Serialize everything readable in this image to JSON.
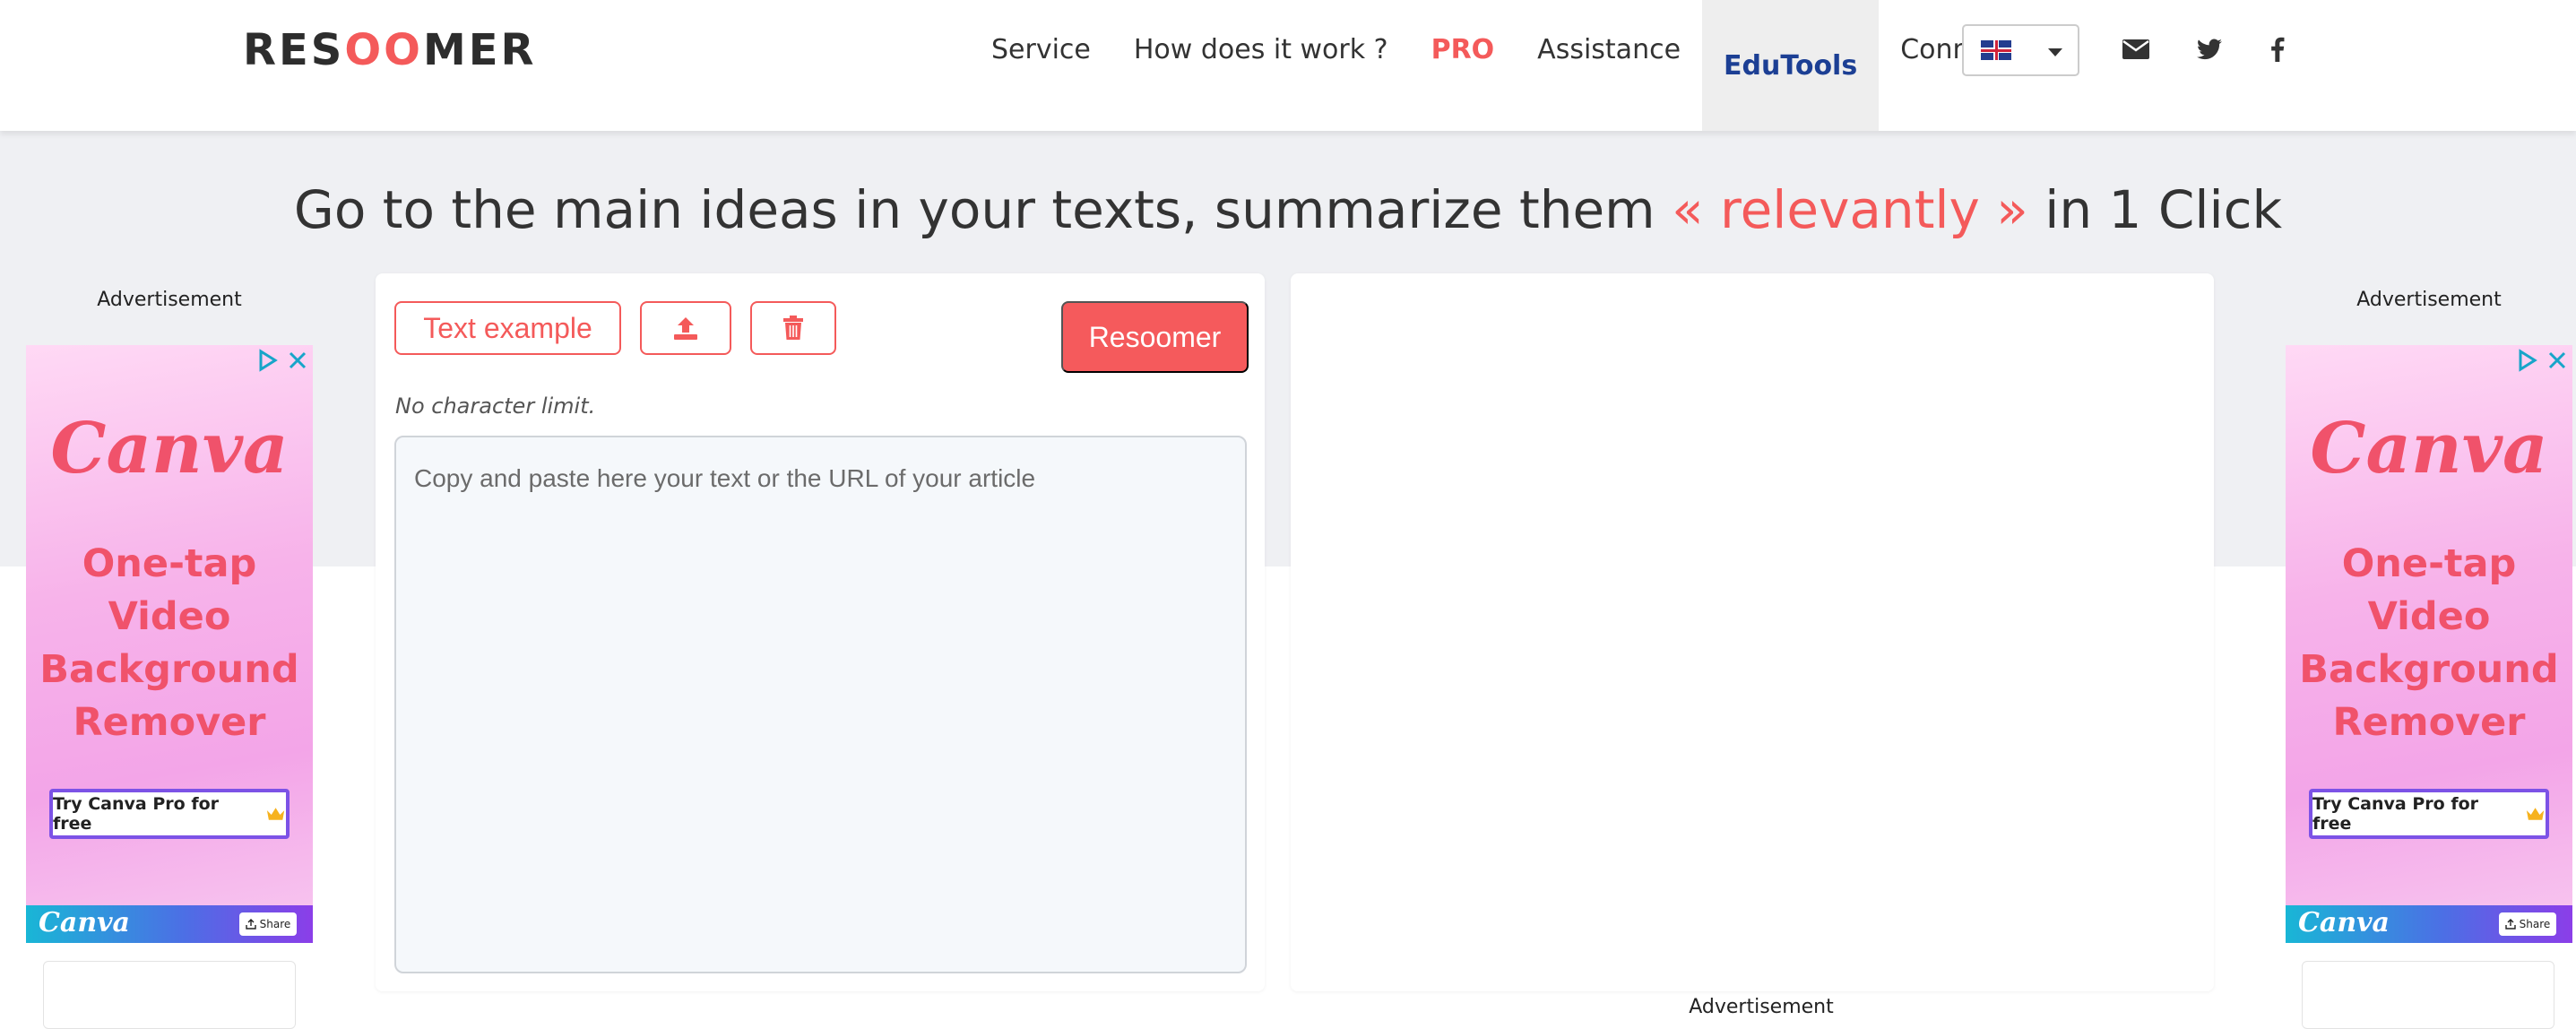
{
  "header": {
    "logo_start": "RES",
    "logo_mid": "OO",
    "logo_end": "MER",
    "nav": [
      {
        "label": "Service"
      },
      {
        "label": "How does it work ?"
      },
      {
        "label": "PRO"
      },
      {
        "label": "Assistance"
      },
      {
        "label": "EduTools"
      },
      {
        "label": "Connexion"
      }
    ],
    "language": "en-GB",
    "social_icons": [
      "envelope-icon",
      "twitter-icon",
      "facebook-icon"
    ]
  },
  "headline": {
    "before": "Go to the main ideas in your texts, summarize them ",
    "accent": "« relevantly »",
    "after": " in 1 Click"
  },
  "tool": {
    "text_example_label": "Text example",
    "upload_icon": "upload-icon",
    "trash_icon": "trash-icon",
    "submit_label": "Resoomer",
    "limit_note": "No character limit.",
    "textarea_placeholder": "Copy and paste here your text or the URL of your article"
  },
  "ads": {
    "label": "Advertisement",
    "brand": "Canva",
    "text_line1": "One-tap",
    "text_line2": "Video",
    "text_line3": "Background",
    "text_line4": "Remover",
    "cta": "Try Canva Pro for free",
    "share": "Share",
    "bottom_label": "Advertisement"
  },
  "colors": {
    "accent": "#f45a5a",
    "edutools": "#1c3f94",
    "band": "#eff0f3"
  }
}
